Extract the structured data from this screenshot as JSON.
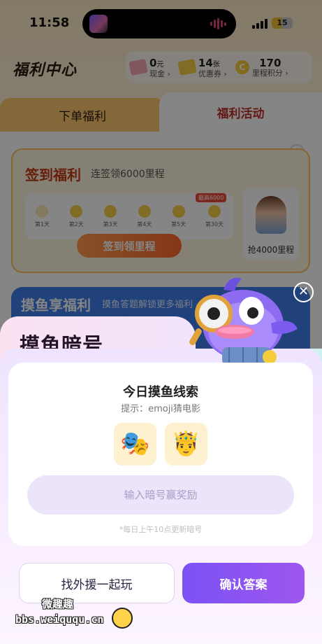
{
  "status_bar": {
    "time": "11:58",
    "battery": "15"
  },
  "header": {
    "title": "福利中心",
    "cash": {
      "value": "0",
      "unit": "元",
      "label": "现金 ›"
    },
    "coupons": {
      "value": "14",
      "unit": "张",
      "label": "优惠券 ›"
    },
    "points": {
      "value": "170",
      "label": "里程积分 ›"
    }
  },
  "tabs": {
    "orders": "下单福利",
    "events": "福利活动"
  },
  "signin_card": {
    "title": "签到福利",
    "subtitle": "连签领6000里程",
    "days": [
      "第1天",
      "第2天",
      "第3天",
      "第4天",
      "第5天",
      "第30天"
    ],
    "bonus_tag": "最高6000",
    "button": "签到领里程",
    "grab_label": "抢4000里程"
  },
  "fish_card": {
    "title": "摸鱼享福利",
    "subtitle": "摸鱼答题解锁更多福利"
  },
  "modal": {
    "title": "摸鱼暗号",
    "clue_title": "今日摸鱼线索",
    "clue_hint": "提示：emoji猜电影",
    "emojis": [
      "🎭",
      "🤴"
    ],
    "input_placeholder": "输入暗号赢奖励",
    "refresh_note": "*每日上午10点更新暗号",
    "help_button": "找外援一起玩",
    "confirm_button": "确认答案",
    "close": "✕"
  },
  "watermark": {
    "line1": "微趣趣",
    "line2": "bbs.weiququ.cn"
  },
  "colors": {
    "accent_purple": "#8454f2",
    "brand_red": "#c0312c",
    "tab_orange": "#ffc86d"
  }
}
